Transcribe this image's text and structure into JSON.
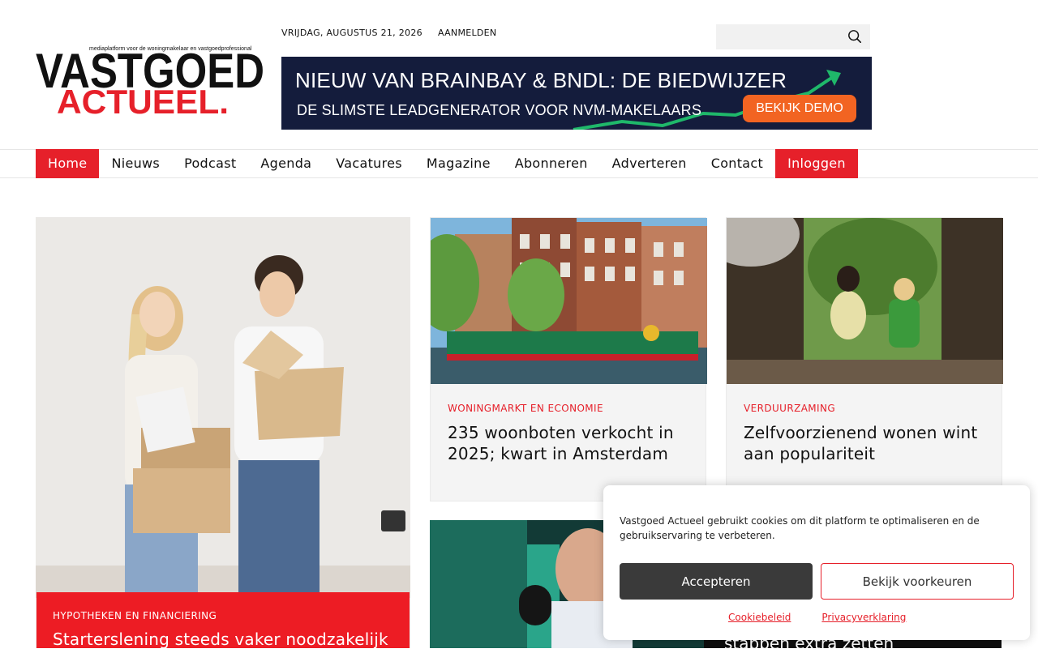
{
  "header": {
    "logo_tagline": "mediaplatform voor de woningmakelaar en vastgoedprofessional",
    "logo_word1": "VASTGOED",
    "logo_word2": "ACTUEEL.",
    "date": "VRIJDAG, AUGUSTUS 21, 2026",
    "login_link": "AANMELDEN",
    "search_placeholder": "",
    "search_icon": "search-icon"
  },
  "banner": {
    "headline": "NIEUW VAN BRAINBAY & BNDL: DE BIEDWIJZER",
    "subline": "DE SLIMSTE LEADGENERATOR VOOR NVM-MAKELAARS",
    "cta": "BEKIJK DEMO",
    "colors": {
      "background": "#141c3c",
      "cta": "#f26422",
      "arrow": "#1fb86a"
    }
  },
  "nav": {
    "items": [
      "Home",
      "Nieuws",
      "Podcast",
      "Agenda",
      "Vacatures",
      "Magazine",
      "Abonneren",
      "Adverteren",
      "Contact",
      "Inloggen"
    ],
    "active": "Home",
    "accent": "#e6202a"
  },
  "articles": {
    "featured": {
      "category": "HYPOTHEKEN EN FINANCIERING",
      "title": "Starterslening steeds vaker noodzakelijk"
    },
    "card1": {
      "category": "WONINGMARKT EN ECONOMIE",
      "title": "235 woonboten verkocht in 2025; kwart in Amsterdam"
    },
    "card2": {
      "category": "VERDUURZAMING",
      "title": "Zelfvoorzienend wonen wint aan populariteit"
    },
    "card4": {
      "title_fragment": "stappen extra zetten"
    }
  },
  "cookie": {
    "message": "Vastgoed Actueel gebruikt cookies om dit platform te optimaliseren en de gebruikservaring te verbeteren.",
    "accept": "Accepteren",
    "preferences": "Bekijk voorkeuren",
    "link_cookie": "Cookiebeleid",
    "link_privacy": "Privacyverklaring"
  }
}
